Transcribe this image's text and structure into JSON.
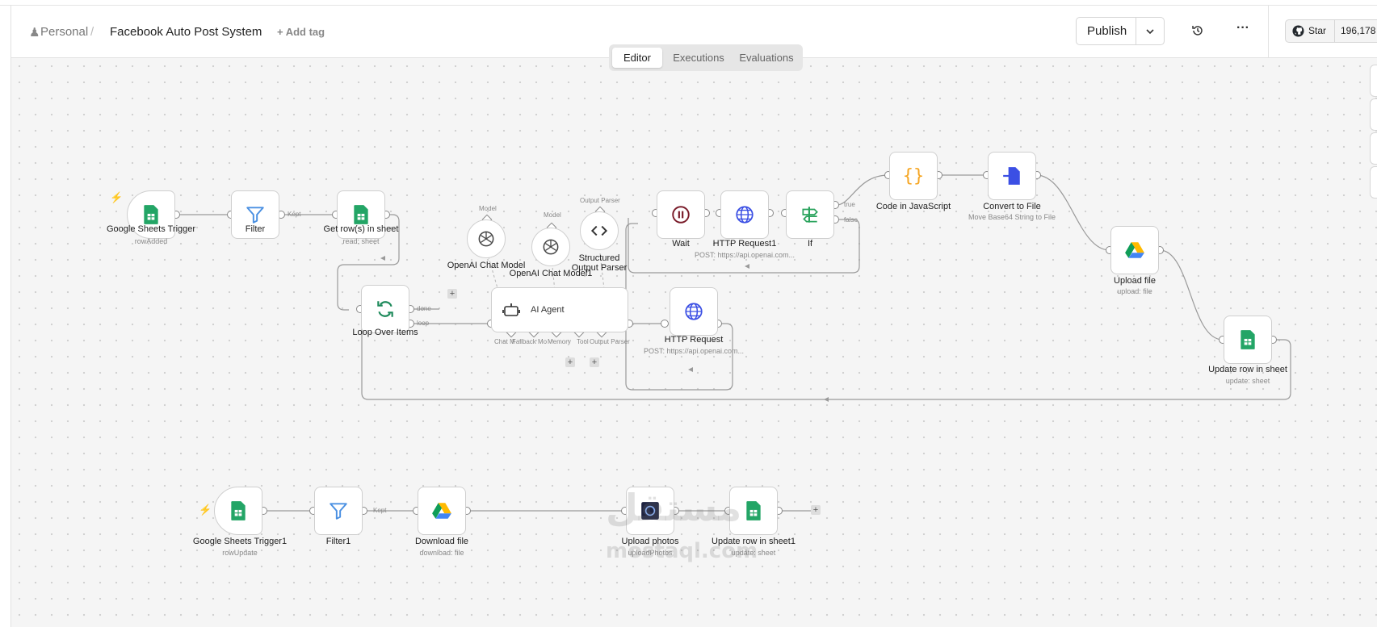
{
  "header": {
    "project": "Personal",
    "separator": "/",
    "workflow_name": "Facebook Auto Post System",
    "add_tag": "+ Add tag",
    "publish": "Publish",
    "more": "···",
    "star": "Star",
    "star_count": "196,178"
  },
  "tabs": [
    "Editor",
    "Executions",
    "Evaluations"
  ],
  "active_tab": "Editor",
  "colors": {
    "sheets_green": "#23a566",
    "google_blue": "#4285f4",
    "loop_green": "#1e8a5b",
    "code_orange": "#f6a623",
    "convert_blue": "#3b4fe4",
    "wait_red": "#7a1c2a",
    "if_green": "#2aa35d",
    "trigger_orange": "#ff8a3d"
  },
  "nodes": {
    "sheets_trigger": {
      "label": "Google Sheets Trigger",
      "sub": "rowAdded"
    },
    "filter": {
      "label": "Filter"
    },
    "get_rows": {
      "label": "Get row(s) in sheet",
      "sub": "read: sheet"
    },
    "loop": {
      "label": "Loop Over Items"
    },
    "openai1": {
      "label": "OpenAI Chat Model"
    },
    "openai2": {
      "label": "OpenAI Chat Model1"
    },
    "parser": {
      "label": "Structured Output Parser"
    },
    "agent": {
      "label": "AI Agent"
    },
    "wait": {
      "label": "Wait"
    },
    "http1": {
      "label": "HTTP Request1",
      "sub": "POST: https://api.openai.com..."
    },
    "if": {
      "label": "If"
    },
    "code": {
      "label": "Code in JavaScript"
    },
    "convert": {
      "label": "Convert to File",
      "sub": "Move Base64 String to File"
    },
    "upload": {
      "label": "Upload file",
      "sub": "upload: file"
    },
    "update_row": {
      "label": "Update row in sheet",
      "sub": "update: sheet"
    },
    "http": {
      "label": "HTTP Request",
      "sub": "POST: https://api.openai.com..."
    },
    "sheets_trigger1": {
      "label": "Google Sheets Trigger1",
      "sub": "rowUpdate"
    },
    "filter1": {
      "label": "Filter1"
    },
    "download": {
      "label": "Download file",
      "sub": "download: file"
    },
    "upload_photos": {
      "label": "Upload photos",
      "sub": "uploadPhotos"
    },
    "update_row1": {
      "label": "Update row in sheet1",
      "sub": "update: sheet"
    }
  },
  "edge_labels": {
    "kept": "Kept",
    "kept2": "Kept",
    "done": "done",
    "loop": "loop",
    "true": "true",
    "false": "false",
    "model": "Model",
    "model2": "Model",
    "output_parser": "Output Parser"
  },
  "agent_ports": {
    "chat": "Chat M",
    "fallback": "Fallback Mo",
    "memory": "Memory",
    "tool": "Tool",
    "output": "Output Parser"
  },
  "watermark": {
    "arabic": "مستقل",
    "latin": "mostaql.com"
  }
}
